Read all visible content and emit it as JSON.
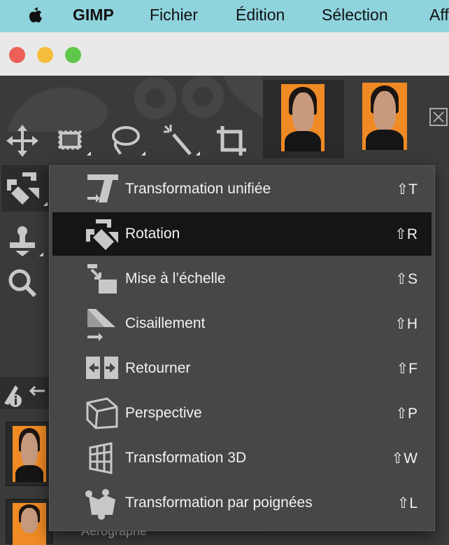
{
  "menubar": {
    "items": [
      "GIMP",
      "Fichier",
      "Édition",
      "Sélection",
      "Aff"
    ]
  },
  "menu": {
    "items": [
      {
        "label": "Transformation unifiée",
        "shortcut": "⇧T",
        "icon": "unified-transform-icon"
      },
      {
        "label": "Rotation",
        "shortcut": "⇧R",
        "icon": "rotate-icon"
      },
      {
        "label": "Mise à l’échelle",
        "shortcut": "⇧S",
        "icon": "scale-icon"
      },
      {
        "label": "Cisaillement",
        "shortcut": "⇧H",
        "icon": "shear-icon"
      },
      {
        "label": "Retourner",
        "shortcut": "⇧F",
        "icon": "flip-icon"
      },
      {
        "label": "Perspective",
        "shortcut": "⇧P",
        "icon": "perspective-icon"
      },
      {
        "label": "Transformation 3D",
        "shortcut": "⇧W",
        "icon": "transform-3d-icon"
      },
      {
        "label": "Transformation par poignées",
        "shortcut": "⇧L",
        "icon": "handle-transform-icon"
      }
    ],
    "highlighted": "Rotation"
  },
  "layers": {
    "partial_label": "Aérographe"
  },
  "colors": {
    "menubar": "#8fd3dd",
    "menu_bg": "#474747",
    "highlight": "#151515",
    "accent_orange": "#f08a24"
  }
}
